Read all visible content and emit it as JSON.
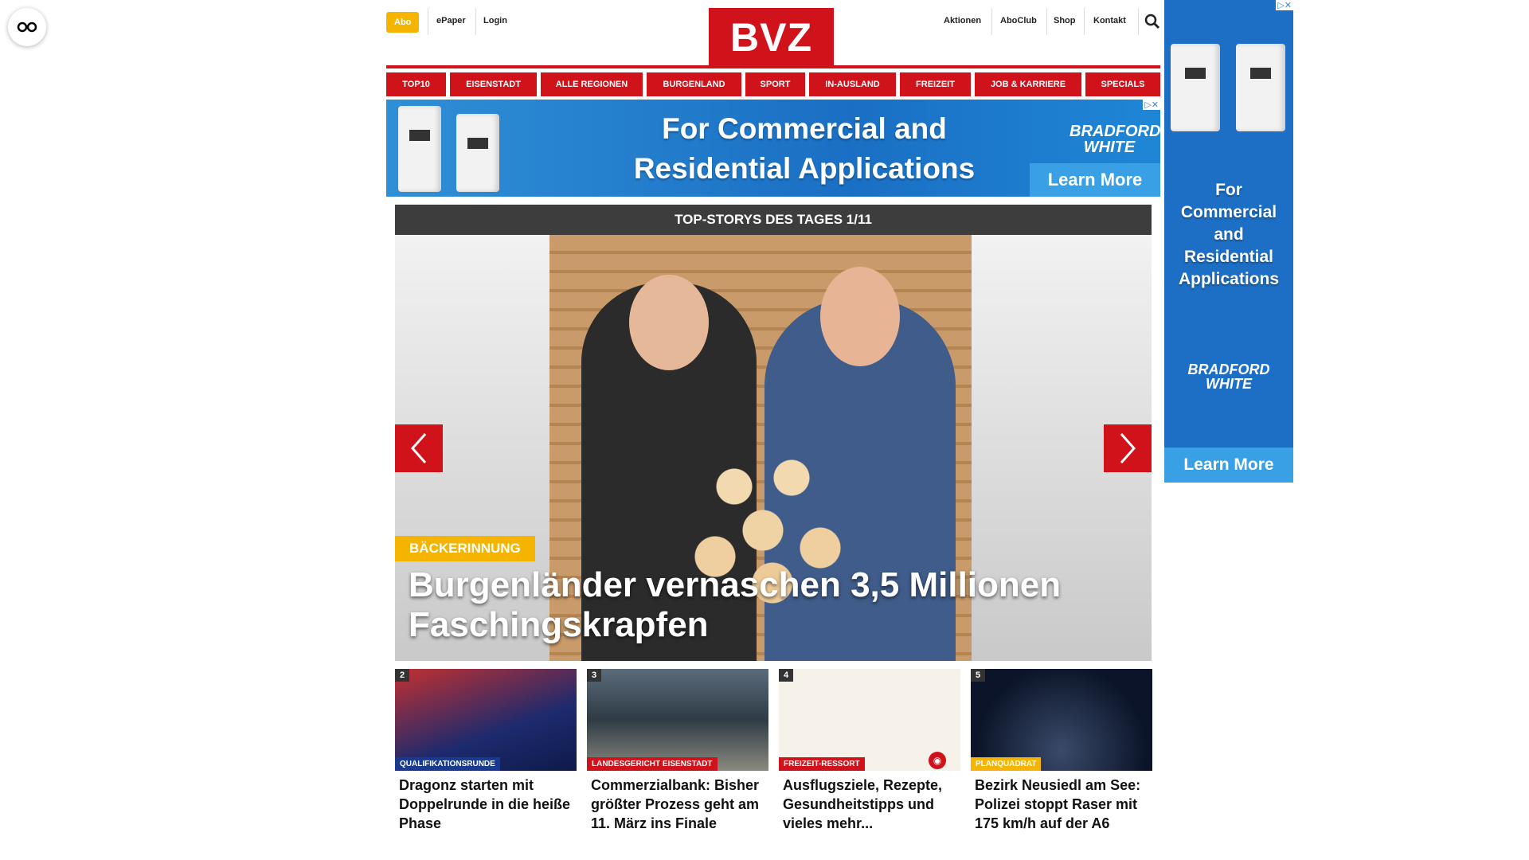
{
  "header": {
    "abo": "Abo",
    "epaper": "ePaper",
    "login": "Login",
    "logo": "BVZ",
    "links": [
      "Aktionen",
      "AboClub",
      "Shop",
      "Kontakt"
    ]
  },
  "nav": [
    "TOP10",
    "EISENSTADT",
    "ALLE REGIONEN",
    "BURGENLAND",
    "SPORT",
    "IN-AUSLAND",
    "FREIZEIT",
    "JOB & KARRIERE",
    "SPECIALS"
  ],
  "ad_top": {
    "line1": "For Commercial and",
    "line2": "Residential Applications",
    "brand1": "BRADFORD",
    "brand2": "WHITE",
    "cta": "Learn More"
  },
  "topstories": {
    "label": "TOP-STORYS DES TAGES 1/11",
    "tag": "BÄCKERINNUNG",
    "headline": "Burgenländer vernaschen 3,5 Millionen Faschingskrapfen"
  },
  "cards": [
    {
      "num": "2",
      "tag": "QUALIFIKATIONSRUNDE",
      "tag_color": "#1a3a8f",
      "title": "Dragonz starten mit Doppelrunde in die heiße Phase"
    },
    {
      "num": "3",
      "tag": "LANDESGERICHT EISENSTADT",
      "tag_color": "#d0121b",
      "title": "Commerzialbank: Bisher größter Prozess geht am 11. März ins Finale"
    },
    {
      "num": "4",
      "tag": "FREIZEIT-RESSORT",
      "tag_color": "#d0121b",
      "title": "Ausflugsziele, Rezepte, Gesundheitstipps und vieles mehr..."
    },
    {
      "num": "5",
      "tag": "PLANQUADRAT",
      "tag_color": "#f5b400",
      "title": "Bezirk Neusiedl am See: Polizei stoppt Raser mit 175 km/h auf der A6"
    }
  ],
  "ad_side": {
    "line1": "For",
    "line2": "Commercial",
    "line3": "and",
    "line4": "Residential",
    "line5": "Applications",
    "brand1": "BRADFORD",
    "brand2": "WHITE",
    "cta": "Learn More"
  },
  "colors": {
    "brand_red": "#d0121b",
    "accent_yellow": "#f5b400",
    "ad_blue": "#1d6fc5"
  }
}
